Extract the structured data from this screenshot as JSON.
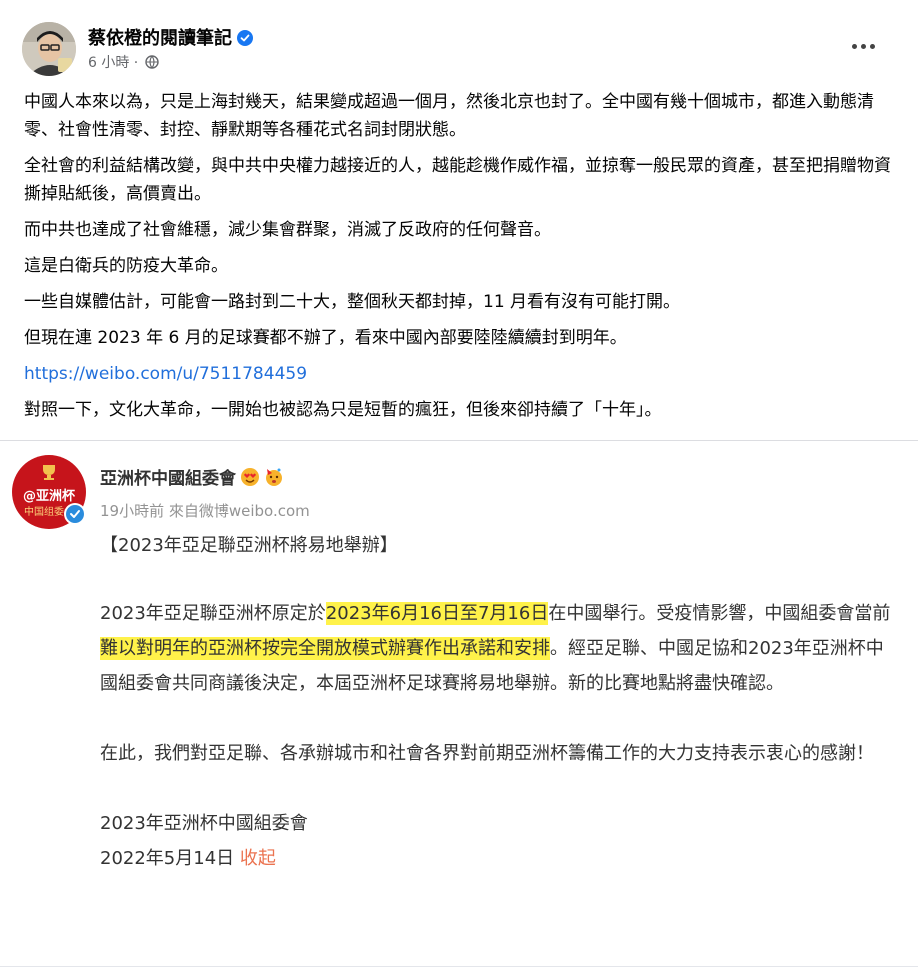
{
  "post": {
    "author": "蔡依橙的閱讀筆記",
    "time": "6 小時",
    "time_sep": " · ",
    "paragraphs": [
      "中國人本來以為，只是上海封幾天，結果變成超過一個月，然後北京也封了。全中國有幾十個城市，都進入動態清零、社會性清零、封控、靜默期等各種花式名詞封閉狀態。",
      "全社會的利益結構改變，與中共中央權力越接近的人，越能趁機作威作福，並掠奪一般民眾的資產，甚至把捐贈物資撕掉貼紙後，高價賣出。",
      "而中共也達成了社會維穩，減少集會群聚，消滅了反政府的任何聲音。",
      "這是白衛兵的防疫大革命。",
      "一些自媒體估計，可能會一路封到二十大，整個秋天都封掉，11 月看有沒有可能打開。",
      "但現在連 2023 年 6 月的足球賽都不辦了，看來中國內部要陸陸續續封到明年。"
    ],
    "link": "https://weibo.com/u/7511784459",
    "last_paragraph": "對照一下，文化大革命，一開始也被認為只是短暫的瘋狂，但後來卻持續了「十年」。"
  },
  "weibo": {
    "avatar_text_1": "@亚洲杯",
    "avatar_text_2": "中国组委会",
    "name": "亞洲杯中國組委會",
    "meta": "19小時前  來自微博weibo.com",
    "title": "【2023年亞足聯亞洲杯將易地舉辦】",
    "p1_a": "2023年亞足聯亞洲杯原定於",
    "p1_hl1": "2023年6月16日至7月16日",
    "p1_b": "在中國舉行。受疫情影響，中國組委會當前",
    "p1_hl2": "難以對明年的亞洲杯按完全開放模式辦賽作出承諾和安排",
    "p1_c": "。經亞足聯、中國足協和2023年亞洲杯中國組委會共同商議後決定，本屆亞洲杯足球賽將易地舉辦。新的比賽地點將盡快確認。",
    "p2": "在此，我們對亞足聯、各承辦城市和社會各界對前期亞洲杯籌備工作的大力支持表示衷心的感謝！",
    "signature": "2023年亞洲杯中國組委會",
    "date": "2022年5月14日 ",
    "collapse": "收起"
  },
  "colors": {
    "link": "#216fdb",
    "verified": "#1877f2",
    "highlight": "#fff24a",
    "collapse": "#eb7350",
    "weibo_red": "#c6141b"
  },
  "icons": [
    "verified-badge-icon",
    "globe-icon",
    "more-options-icon",
    "emoji-heart-eyes-icon",
    "emoji-party-icon"
  ]
}
